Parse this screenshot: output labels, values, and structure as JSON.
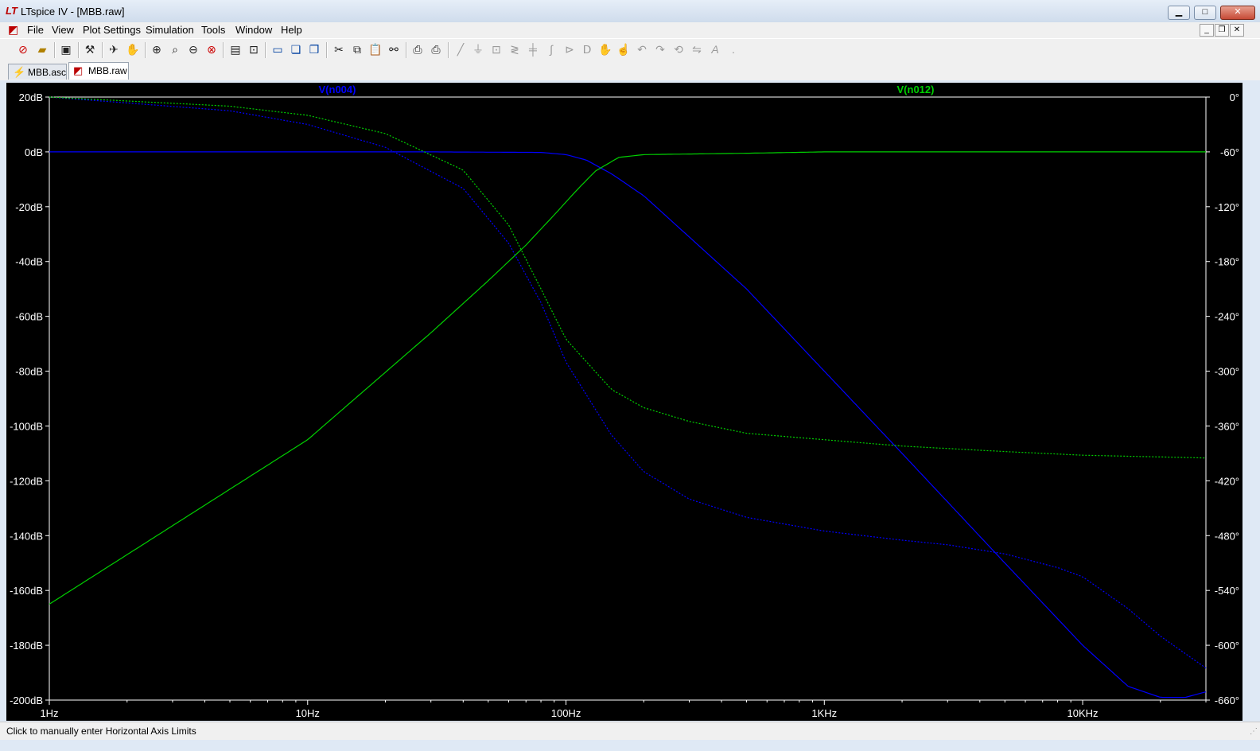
{
  "window": {
    "title": "LTspice IV - [MBB.raw]"
  },
  "menu": {
    "items": [
      "File",
      "View",
      "Plot Settings",
      "Simulation",
      "Tools",
      "Window",
      "Help"
    ]
  },
  "tabs": [
    {
      "label": "MBB.asc"
    },
    {
      "label": "MBB.raw"
    }
  ],
  "status": {
    "text": "Click to manually enter Horizontal Axis Limits"
  },
  "chart_data": {
    "type": "line",
    "x_scale": "log",
    "xlim": [
      1,
      30000
    ],
    "left_axis": {
      "label": "",
      "unit": "dB",
      "ticks": [
        "20dB",
        "0dB",
        "-20dB",
        "-40dB",
        "-60dB",
        "-80dB",
        "-100dB",
        "-120dB",
        "-140dB",
        "-160dB",
        "-180dB",
        "-200dB"
      ],
      "range": [
        -200,
        20
      ]
    },
    "right_axis": {
      "label": "",
      "unit": "deg",
      "ticks": [
        "0°",
        "-60°",
        "-120°",
        "-180°",
        "-240°",
        "-300°",
        "-360°",
        "-420°",
        "-480°",
        "-540°",
        "-600°",
        "-660°"
      ],
      "range": [
        -660,
        0
      ]
    },
    "x_ticks": [
      {
        "value": 1,
        "label": "1Hz"
      },
      {
        "value": 10,
        "label": "10Hz"
      },
      {
        "value": 100,
        "label": "100Hz"
      },
      {
        "value": 1000,
        "label": "1KHz"
      },
      {
        "value": 10000,
        "label": "10KHz"
      }
    ],
    "grid": false,
    "series": [
      {
        "name": "V(n004)",
        "color": "#0000ff",
        "kind": "magnitude",
        "x": [
          1,
          30,
          80,
          100,
          120,
          150,
          200,
          500,
          1000,
          2000,
          5000,
          10000,
          15000,
          20000,
          25000,
          30000
        ],
        "y": [
          0,
          0,
          -0.2,
          -1,
          -3,
          -8,
          -16,
          -50,
          -80,
          -110,
          -150,
          -180,
          -195,
          -199,
          -199,
          -197
        ]
      },
      {
        "name": "V(n004)",
        "color": "#0000ff",
        "kind": "phase",
        "x": [
          1,
          5,
          10,
          20,
          40,
          60,
          80,
          100,
          150,
          200,
          300,
          500,
          1000,
          2000,
          3000,
          5000,
          8000,
          10000,
          15000,
          20000,
          30000
        ],
        "y": [
          0,
          -15,
          -30,
          -55,
          -100,
          -160,
          -225,
          -290,
          -370,
          -410,
          -440,
          -460,
          -475,
          -485,
          -490,
          -500,
          -515,
          -525,
          -560,
          -590,
          -625
        ]
      },
      {
        "name": "V(n012)",
        "color": "#00d000",
        "kind": "magnitude",
        "x": [
          1,
          10,
          30,
          50,
          70,
          90,
          110,
          130,
          160,
          200,
          500,
          1000,
          30000
        ],
        "y": [
          -165,
          -105,
          -66,
          -47,
          -34,
          -23,
          -14,
          -7,
          -2,
          -1,
          -0.5,
          0,
          0
        ]
      },
      {
        "name": "V(n012)",
        "color": "#00d000",
        "kind": "phase",
        "x": [
          1,
          5,
          10,
          20,
          40,
          60,
          80,
          100,
          150,
          200,
          300,
          500,
          1000,
          2000,
          5000,
          10000,
          30000
        ],
        "y": [
          0,
          -10,
          -20,
          -40,
          -80,
          -140,
          -210,
          -265,
          -320,
          -340,
          -355,
          -368,
          -375,
          -382,
          -388,
          -392,
          -395
        ]
      }
    ]
  }
}
